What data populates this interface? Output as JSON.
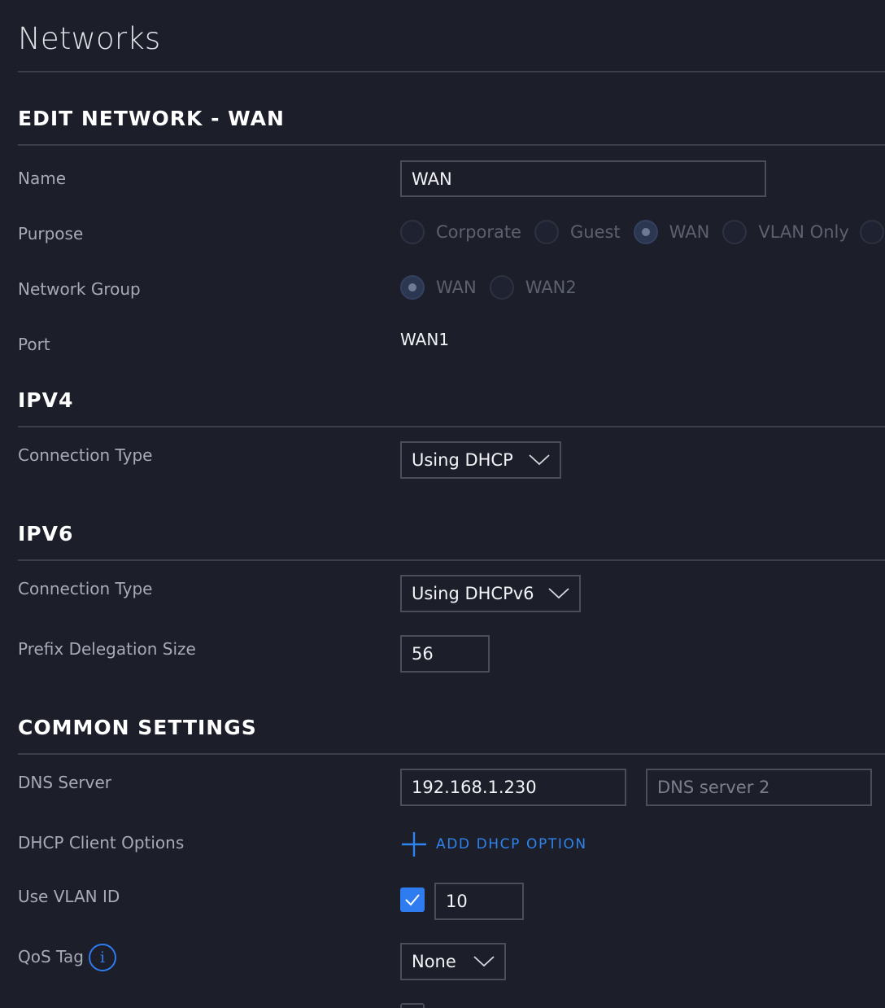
{
  "page": {
    "title": "Networks"
  },
  "edit_section": {
    "title": "EDIT NETWORK - WAN"
  },
  "name": {
    "label": "Name",
    "value": "WAN"
  },
  "purpose": {
    "label": "Purpose",
    "options": [
      "Corporate",
      "Guest",
      "WAN",
      "VLAN Only"
    ],
    "selected": "WAN"
  },
  "network_group": {
    "label": "Network Group",
    "options": [
      "WAN",
      "WAN2"
    ],
    "selected": "WAN"
  },
  "port": {
    "label": "Port",
    "value": "WAN1"
  },
  "ipv4": {
    "title": "IPV4",
    "connection_label": "Connection Type",
    "connection_value": "Using DHCP"
  },
  "ipv6": {
    "title": "IPV6",
    "connection_label": "Connection Type",
    "connection_value": "Using DHCPv6",
    "prefix_label": "Prefix Delegation Size",
    "prefix_value": "56"
  },
  "common": {
    "title": "COMMON SETTINGS",
    "dns_label": "DNS Server",
    "dns1_value": "192.168.1.230",
    "dns2_placeholder": "DNS server 2",
    "dhcp_label": "DHCP Client Options",
    "add_dhcp_label": "ADD DHCP OPTION",
    "vlan_label": "Use VLAN ID",
    "vlan_checked": true,
    "vlan_value": "10",
    "qos_label": "QoS Tag",
    "qos_value": "None"
  },
  "colors": {
    "background": "#1c1e2a",
    "accent": "#2f7bf0",
    "link": "#2f84ee"
  }
}
